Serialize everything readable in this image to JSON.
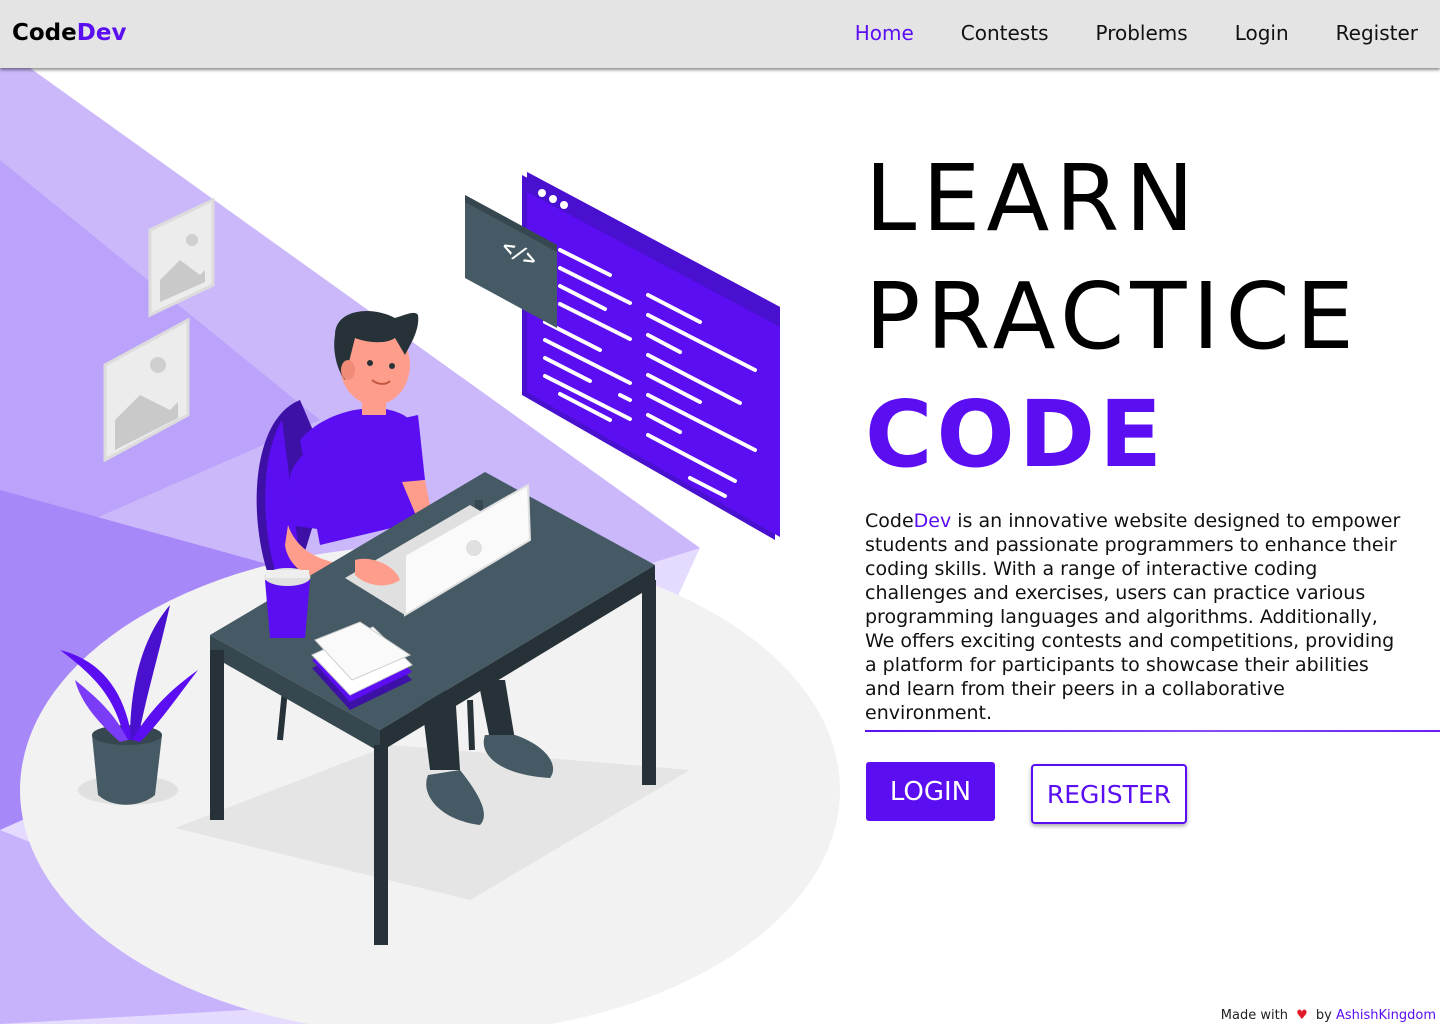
{
  "navbar": {
    "brand_prefix": "Code",
    "brand_accent": "Dev",
    "links": [
      {
        "label": "Home",
        "active": true
      },
      {
        "label": "Contests",
        "active": false
      },
      {
        "label": "Problems",
        "active": false
      },
      {
        "label": "Login",
        "active": false
      },
      {
        "label": "Register",
        "active": false
      }
    ]
  },
  "hero": {
    "line1": "LEARN",
    "line2": "PRACTICE",
    "line3": "CODE"
  },
  "description": {
    "brand_prefix": "Code",
    "brand_accent": "Dev",
    "text": " is an innovative website designed to empower students and passionate programmers to enhance their coding skills. With a range of interactive coding challenges and exercises, users can practice various programming languages and algorithms. Additionally, We offers exciting contests and competitions, providing a platform for participants to showcase their abilities and learn from their peers in a collaborative environment."
  },
  "buttons": {
    "login_label": "LOGIN",
    "register_label": "REGISTER"
  },
  "illustration": {
    "code_tag": "</>"
  },
  "footer": {
    "made_with": "Made with",
    "heart": "♥",
    "by": "by",
    "author": "AshishKingdom"
  },
  "colors": {
    "accent": "#5b0ef2",
    "navbar_bg": "#e4e4e4",
    "desk": "#455a64"
  }
}
